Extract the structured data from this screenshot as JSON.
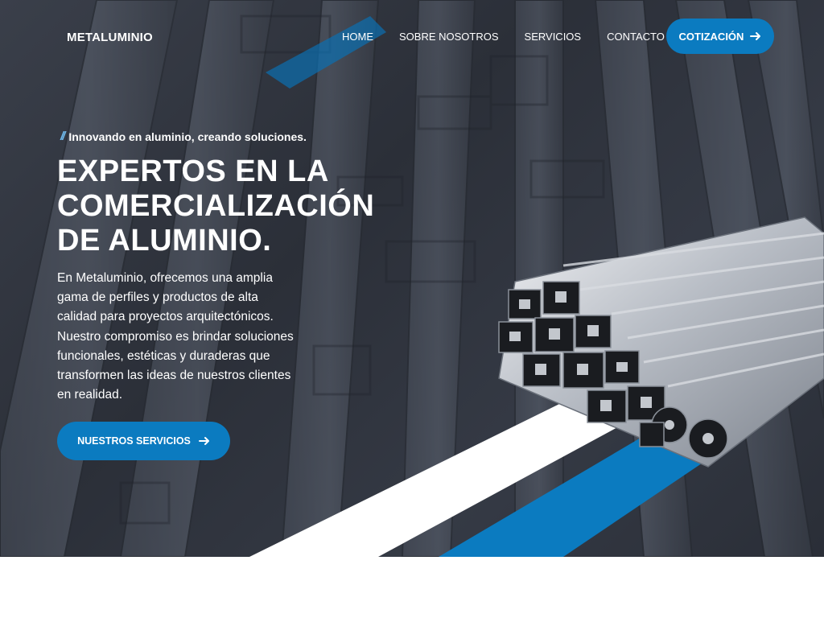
{
  "brand": {
    "logo": "METALUMINIO"
  },
  "nav": {
    "items": [
      {
        "label": "HOME"
      },
      {
        "label": "SOBRE NOSOTROS"
      },
      {
        "label": "SERVICIOS"
      },
      {
        "label": "CONTACTO"
      }
    ],
    "cta_label": "COTIZACIÓN"
  },
  "hero": {
    "tagline": "Innovando en aluminio, creando soluciones.",
    "headline_lines": [
      "EXPERTOS EN LA",
      "COMERCIALIZACIÓN",
      "DE ALUMINIO."
    ],
    "description": "En Metaluminio, ofrecemos una amplia gama de perfiles y productos de alta calidad para proyectos arquitectónicos. Nuestro compromiso es brindar soluciones funcionales, estéticas y duraderas que transformen las ideas de nuestros clientes en realidad.",
    "cta_label": "NUESTROS SERVICIOS"
  },
  "icons": {
    "cta_top_icon": "arrow-right-icon",
    "cta_main_icon": "arrow-right-icon",
    "tagline_icon": "double-slash-icon"
  },
  "colors": {
    "accent": "#0b7bc0",
    "hero_background": "#30353f",
    "text_light": "#ffffff"
  }
}
